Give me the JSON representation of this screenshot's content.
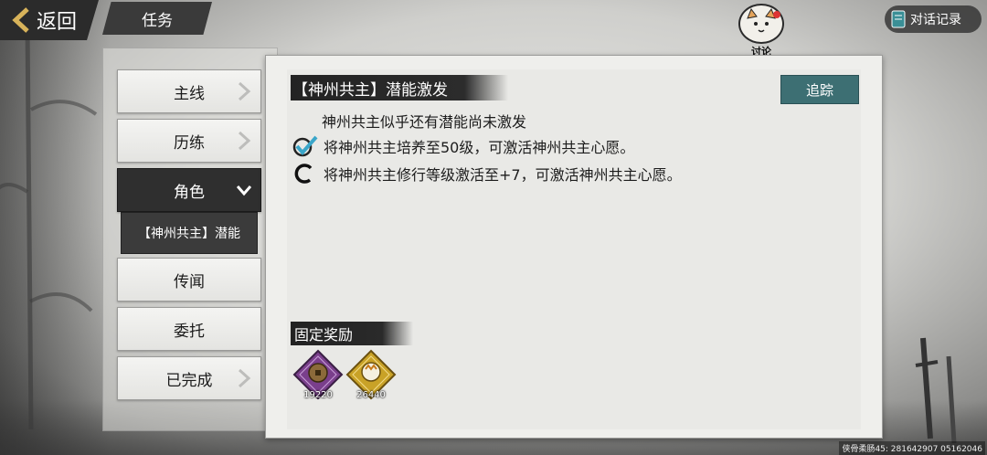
{
  "topbar": {
    "back_label": "返回",
    "tab_title": "任务",
    "discuss_label": "讨论",
    "dialog_record_label": "对话记录"
  },
  "menu": {
    "items": [
      {
        "label": "主线",
        "state": "collapsed"
      },
      {
        "label": "历练",
        "state": "collapsed"
      },
      {
        "label": "角色",
        "state": "expanded"
      },
      {
        "label": "传闻",
        "state": "none"
      },
      {
        "label": "委托",
        "state": "none"
      },
      {
        "label": "已完成",
        "state": "collapsed"
      }
    ],
    "sub_item": "【神州共主】潜能"
  },
  "quest": {
    "title": "【神州共主】潜能激发",
    "track_label": "追踪",
    "description": "神州共主似乎还有潜能尚未激发",
    "conditions": [
      {
        "text": "将神州共主培养至50级，可激活神州共主心愿。",
        "status": "done"
      },
      {
        "text": "将神州共主修行等级激活至+7，可激活神州共主心愿。",
        "status": "in-progress"
      }
    ]
  },
  "rewards": {
    "title": "固定奖励",
    "items": [
      {
        "icon": "coin-icon",
        "count": "19220",
        "color": "#7a3f8c"
      },
      {
        "icon": "exp-icon",
        "count": "26440",
        "color": "#c9a227"
      }
    ]
  },
  "footer": {
    "uid": "侠骨柔肠45: 281642907  05162046"
  },
  "colors": {
    "accent": "#3d6f73",
    "active_menu": "#2f2f2f"
  }
}
